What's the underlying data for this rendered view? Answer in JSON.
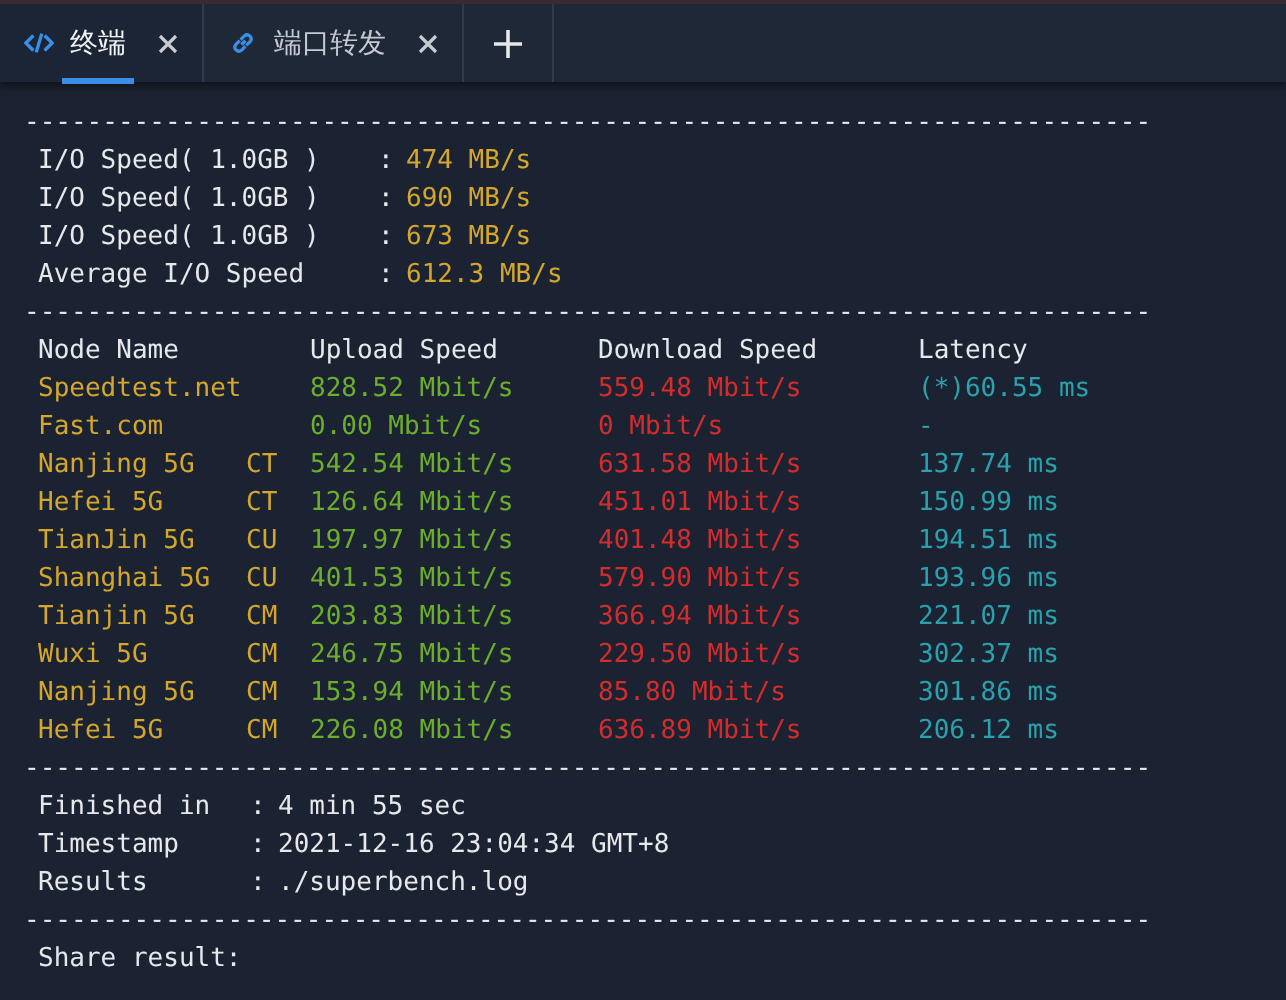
{
  "tabs": [
    {
      "kind": "terminal",
      "label": "终端",
      "selected": true
    },
    {
      "kind": "link",
      "label": "端口转发",
      "selected": false
    }
  ],
  "separators": [
    "------------------------------------------------------------------------",
    "------------------------------------------------------------------------",
    "------------------------------------------------------------------------",
    "------------------------------------------------------------------------"
  ],
  "io_results": [
    {
      "label": "I/O Speed( 1.0GB )",
      "colon": ":",
      "value": "474 MB/s"
    },
    {
      "label": "I/O Speed( 1.0GB )",
      "colon": ":",
      "value": "690 MB/s"
    },
    {
      "label": "I/O Speed( 1.0GB )",
      "colon": ":",
      "value": "673 MB/s"
    },
    {
      "label": "Average I/O Speed",
      "colon": ":",
      "value": "612.3 MB/s"
    }
  ],
  "speed_table": {
    "columns": [
      "Node Name",
      "Upload Speed",
      "Download Speed",
      "Latency"
    ],
    "rows": [
      {
        "node": "Speedtest.net",
        "upload": "828.52 Mbit/s",
        "download": "559.48 Mbit/s",
        "latency": "(*)60.55 ms"
      },
      {
        "node": "Fast.com",
        "upload": "0.00 Mbit/s",
        "download": "0 Mbit/s",
        "latency": "-"
      },
      {
        "node": "Nanjing 5G",
        "isp": "CT",
        "upload": "542.54 Mbit/s",
        "download": "631.58 Mbit/s",
        "latency": "137.74 ms"
      },
      {
        "node": "Hefei 5G",
        "isp": "CT",
        "upload": "126.64 Mbit/s",
        "download": "451.01 Mbit/s",
        "latency": "150.99 ms"
      },
      {
        "node": "TianJin 5G",
        "isp": "CU",
        "upload": "197.97 Mbit/s",
        "download": "401.48 Mbit/s",
        "latency": "194.51 ms"
      },
      {
        "node": "Shanghai 5G",
        "isp": "CU",
        "upload": "401.53 Mbit/s",
        "download": "579.90 Mbit/s",
        "latency": "193.96 ms"
      },
      {
        "node": "Tianjin 5G",
        "isp": "CM",
        "upload": "203.83 Mbit/s",
        "download": "366.94 Mbit/s",
        "latency": "221.07 ms"
      },
      {
        "node": "Wuxi 5G",
        "isp": "CM",
        "upload": "246.75 Mbit/s",
        "download": "229.50 Mbit/s",
        "latency": "302.37 ms"
      },
      {
        "node": "Nanjing 5G",
        "isp": "CM",
        "upload": "153.94 Mbit/s",
        "download": "85.80 Mbit/s",
        "latency": "301.86 ms"
      },
      {
        "node": "Hefei 5G",
        "isp": "CM",
        "upload": "226.08 Mbit/s",
        "download": "636.89 Mbit/s",
        "latency": "206.12 ms"
      }
    ]
  },
  "summary": [
    {
      "label": "Finished in",
      "colon": ":",
      "value": "4 min 55 sec"
    },
    {
      "label": "Timestamp",
      "colon": ":",
      "value": "2021-12-16 23:04:34 GMT+8"
    },
    {
      "label": "Results",
      "colon": ":",
      "value": "./superbench.log"
    }
  ],
  "share_label": "Share result:"
}
